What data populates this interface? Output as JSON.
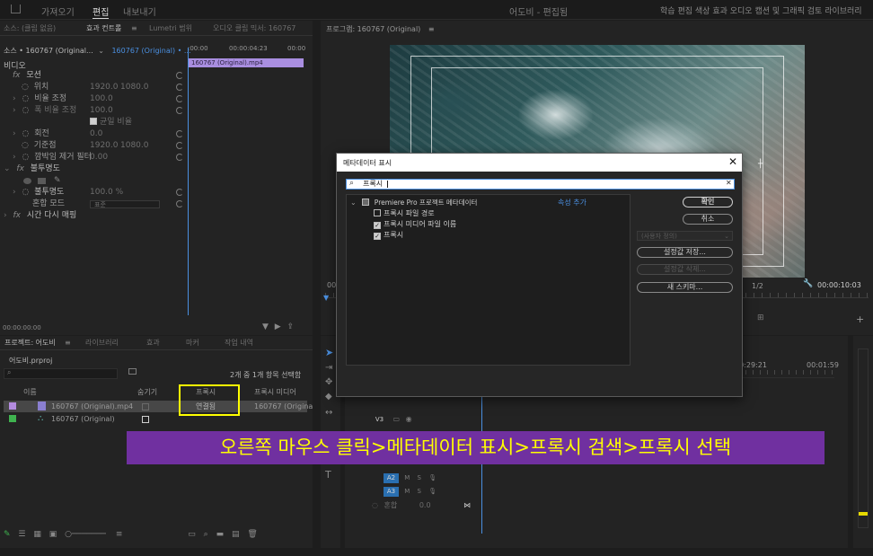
{
  "menu": {
    "home": "가져오기",
    "edit": "편집",
    "export": "내보내기",
    "title": "어도비 - 편집됨",
    "workspaces": [
      "학습",
      "편집",
      "색상",
      "효과",
      "오디오",
      "캡션 및 그래픽",
      "검토",
      "라이브러리"
    ]
  },
  "source_panel": {
    "tabs": [
      "소스: (클립 없음)",
      "효과 컨트롤",
      "Lumetri 범위",
      "오디오 클립 믹서: 160767"
    ],
    "clip_selector": "소스 • 160767 (Original...",
    "clip_selector_target": "160767 (Original) • ...",
    "time_start": ":00:00",
    "time_mid": "00:00:04:23",
    "time_end": "00:00",
    "clip_bar": "160767 (Original).mp4",
    "section_video": "비디오",
    "rows": [
      {
        "fx": "fx",
        "label": "모션",
        "v1": "",
        "v2": ""
      },
      {
        "fx": "",
        "label": "위치",
        "v1": "1920.0",
        "v2": "1080.0"
      },
      {
        "fx": "",
        "label": "비율 조정",
        "v1": "100.0",
        "v2": ""
      },
      {
        "fx": "",
        "label": "폭 비율 조정",
        "v1": "100.0",
        "v2": ""
      },
      {
        "fx": "",
        "label": "",
        "v1": "균일 비율",
        "v2": ""
      },
      {
        "fx": "",
        "label": "회전",
        "v1": "0.0",
        "v2": ""
      },
      {
        "fx": "",
        "label": "기준점",
        "v1": "1920.0",
        "v2": "1080.0"
      },
      {
        "fx": "",
        "label": "깜박임 제거 필터",
        "v1": "0.00",
        "v2": ""
      },
      {
        "fx": "fx",
        "label": "불투명도",
        "v1": "",
        "v2": ""
      },
      {
        "fx": "",
        "label": "",
        "v1": "",
        "v2": ""
      },
      {
        "fx": "",
        "label": "불투명도",
        "v1": "100.0 %",
        "v2": ""
      },
      {
        "fx": "",
        "label": "혼합 모드",
        "v1": "표준",
        "v2": ""
      },
      {
        "fx": "fx",
        "label": "시간 다시 매핑",
        "v1": "",
        "v2": ""
      }
    ],
    "timecode": "00:00:00:00"
  },
  "program_panel": {
    "title": "프로그램: 160767 (Original)",
    "timecode_left": "00",
    "fit": "1/2",
    "timecode_right": "00:00:10:03"
  },
  "project_panel": {
    "tabs": [
      "프로젝트: 어도비",
      "라이브러리",
      "효과",
      "마커",
      "작업 내역"
    ],
    "file": "어도비.prproj",
    "count": "2개 중 1개 항목 선택함",
    "columns": [
      "이름",
      "숨기기",
      "프록시",
      "프록시 미디어"
    ],
    "rows": [
      {
        "name": "160767 (Original).mp4",
        "proxy": "연결됨",
        "proxy_media": "160767 (Origina",
        "color": "#b48ce0"
      },
      {
        "name": "160767 (Original)",
        "proxy": "",
        "proxy_media": "",
        "color": "#3fb34f"
      }
    ]
  },
  "timeline": {
    "time_a": "00:29:21",
    "time_b": "00:01:59",
    "tracks": [
      "V3",
      "A2",
      "A3"
    ],
    "mix_label": "혼합",
    "mix_value": "0.0"
  },
  "dialog": {
    "title": "메타데이터 표시",
    "search_value": "프록시",
    "tree_root": "Premiere Pro 프로젝트 메타데이터",
    "add_property": "속성 추가",
    "items": [
      {
        "label": "프록시 파일 경로",
        "checked": false
      },
      {
        "label": "프록시 미디어 파일 이름",
        "checked": true
      },
      {
        "label": "프록시",
        "checked": true
      }
    ],
    "ok": "확인",
    "cancel": "취소",
    "preset": "(사용자 정의)",
    "save_settings": "설정값 저장...",
    "delete_settings": "설정값 삭제...",
    "new_schema": "새 스키마..."
  },
  "caption": "오른쪽 마우스 클릭>메타데이터 표시>프록시 검색>프록시 선택",
  "colors": {
    "accent": "#4a8fe0",
    "caption_bg": "#7030a0",
    "caption_text": "#ffff00",
    "highlight_box": "#ffff00",
    "clip_bar": "#a98ee0"
  }
}
